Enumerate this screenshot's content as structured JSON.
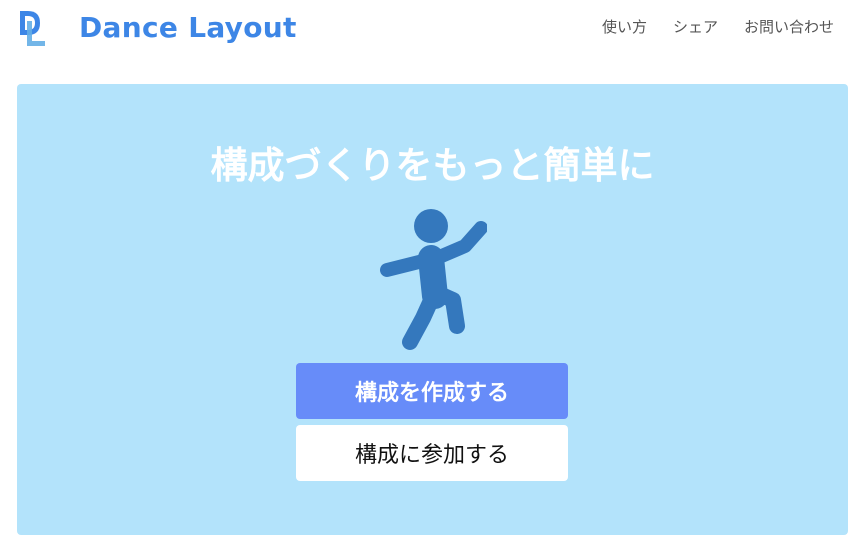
{
  "header": {
    "brand": "Dance Layout",
    "logo_letters": "DL",
    "nav": [
      {
        "label": "使い方"
      },
      {
        "label": "シェア"
      },
      {
        "label": "お問い合わせ"
      }
    ]
  },
  "hero": {
    "title": "構成づくりをもっと簡単に",
    "illustration": "dancing-person-icon",
    "create_button": "構成を作成する",
    "join_button": "構成に参加する"
  },
  "colors": {
    "brand": "#3d86e6",
    "hero_background": "#b3e3fb",
    "primary_button": "#678cf9",
    "dancer": "#3478bd"
  }
}
